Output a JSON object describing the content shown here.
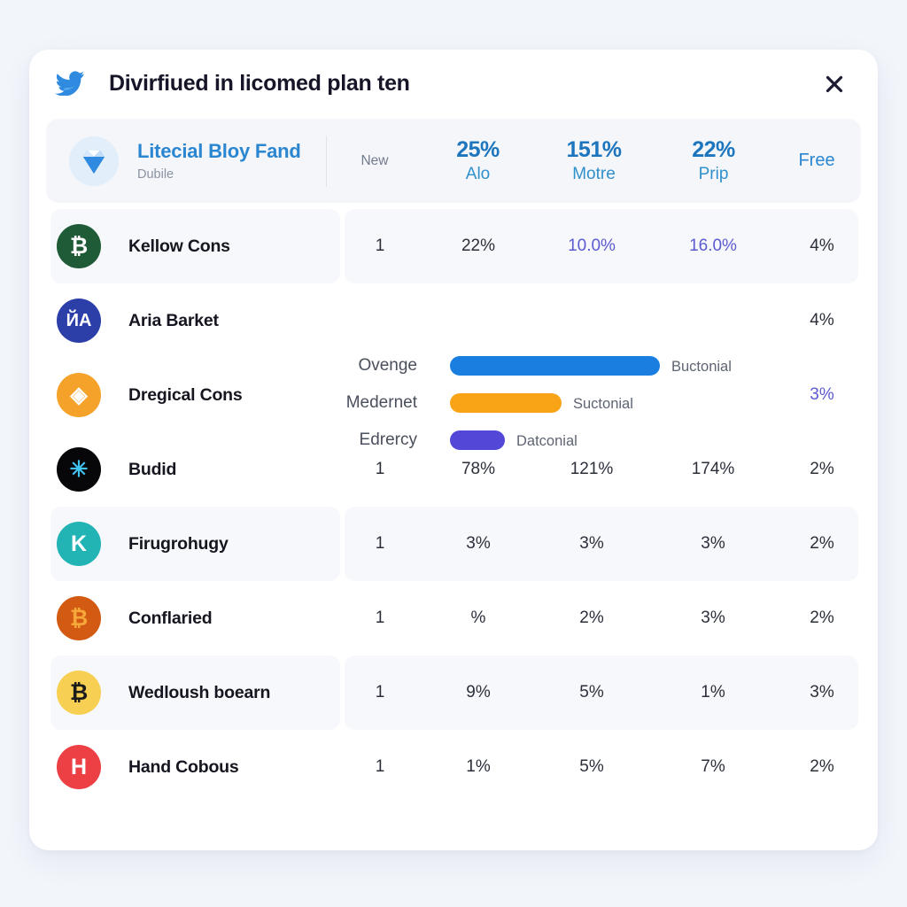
{
  "window": {
    "title": "Divirfiued in licomed plan ten",
    "brand_icon": "twitter-bird-icon",
    "close_icon": "close-icon",
    "page_background": "#f2f5fa",
    "card_background": "#ffffff"
  },
  "summary": {
    "avatar_icon": "diamond-icon",
    "title": "Litecial Bloy Fand",
    "subtitle": "Dubile",
    "new_label": "New",
    "free_label": "Free",
    "metrics": [
      {
        "value": "25%",
        "label": "Alo"
      },
      {
        "value": "151%",
        "label": "Motre"
      },
      {
        "value": "22%",
        "label": "Prip"
      }
    ],
    "accent_color": "#2a86d0"
  },
  "table": {
    "rows": [
      {
        "icon": "bluetooth-coin-icon",
        "icon_bg": "#1f5b36",
        "icon_fg": "#ffffff",
        "glyph": "₿",
        "name": "Kellow Cons",
        "cells": [
          {
            "text": "1",
            "accent": false
          },
          {
            "text": "22%",
            "accent": false
          },
          {
            "text": "10.0%",
            "accent": true
          },
          {
            "text": "16.0%",
            "accent": true
          },
          {
            "text": "4%",
            "accent": false
          }
        ],
        "shaded": true
      },
      {
        "icon": "la-coin-icon",
        "icon_bg": "#2c3fa8",
        "icon_fg": "#ffffff",
        "glyph": "ЙA",
        "name": "Aria Barket",
        "cells": [
          {
            "text": "",
            "accent": false
          },
          {
            "text": "",
            "accent": false
          },
          {
            "text": "",
            "accent": false
          },
          {
            "text": "",
            "accent": false
          },
          {
            "text": "4%",
            "accent": false
          }
        ],
        "shaded": false
      },
      {
        "icon": "diamond-coin-icon",
        "icon_bg": "#f5a22a",
        "icon_fg": "#ffffff",
        "glyph": "◈",
        "name": "Dregical Cons",
        "cells": [
          {
            "text": "",
            "accent": false
          },
          {
            "text": "",
            "accent": false
          },
          {
            "text": "",
            "accent": false
          },
          {
            "text": "",
            "accent": false
          },
          {
            "text": "3%",
            "accent": true
          }
        ],
        "shaded": false
      },
      {
        "icon": "star-coin-icon",
        "icon_bg": "#07070a",
        "icon_fg": "#3fc3f0",
        "glyph": "✳",
        "name": "Budid",
        "cells": [
          {
            "text": "1",
            "accent": false
          },
          {
            "text": "78%",
            "accent": false
          },
          {
            "text": "121%",
            "accent": false
          },
          {
            "text": "174%",
            "accent": false
          },
          {
            "text": "2%",
            "accent": false
          }
        ],
        "shaded": false
      },
      {
        "icon": "k-coin-icon",
        "icon_bg": "#22b3b5",
        "icon_fg": "#ffffff",
        "glyph": "K",
        "name": "Firugrohugy",
        "cells": [
          {
            "text": "1",
            "accent": false
          },
          {
            "text": "3%",
            "accent": false
          },
          {
            "text": "3%",
            "accent": false
          },
          {
            "text": "3%",
            "accent": false
          },
          {
            "text": "2%",
            "accent": false
          }
        ],
        "shaded": true
      },
      {
        "icon": "bitcoin-orange-icon",
        "icon_bg": "#d35a12",
        "icon_fg": "#f6a83a",
        "glyph": "₿",
        "name": "Conflaried",
        "cells": [
          {
            "text": "1",
            "accent": false
          },
          {
            "text": "%",
            "accent": false
          },
          {
            "text": "2%",
            "accent": false
          },
          {
            "text": "3%",
            "accent": false
          },
          {
            "text": "2%",
            "accent": false
          }
        ],
        "shaded": false
      },
      {
        "icon": "bitcoin-gold-icon",
        "icon_bg": "#f7cf52",
        "icon_fg": "#1b1b1b",
        "glyph": "₿",
        "name": "Wedloush boearn",
        "cells": [
          {
            "text": "1",
            "accent": false
          },
          {
            "text": "9%",
            "accent": false
          },
          {
            "text": "5%",
            "accent": false
          },
          {
            "text": "1%",
            "accent": false
          },
          {
            "text": "3%",
            "accent": false
          }
        ],
        "shaded": true
      },
      {
        "icon": "h-coin-icon",
        "icon_bg": "#ec4044",
        "icon_fg": "#ffffff",
        "glyph": "H",
        "name": "Hand Cobous",
        "cells": [
          {
            "text": "1",
            "accent": false
          },
          {
            "text": "1%",
            "accent": false
          },
          {
            "text": "5%",
            "accent": false
          },
          {
            "text": "7%",
            "accent": false
          },
          {
            "text": "2%",
            "accent": false
          }
        ],
        "shaded": false
      }
    ]
  },
  "chart_data": {
    "type": "bar",
    "title": "",
    "orientation": "horizontal",
    "categories": [
      "Ovenge",
      "Medernet",
      "Edrercy"
    ],
    "values": [
      237,
      126,
      62
    ],
    "value_labels": [
      "Buctonial",
      "Suctonial",
      "Datconial"
    ],
    "colors": [
      "#1a7ee0",
      "#f9a317",
      "#5347d8"
    ],
    "xlabel": "",
    "ylabel": "",
    "grid": false,
    "legend": "none",
    "xlim": [
      0,
      260
    ]
  }
}
